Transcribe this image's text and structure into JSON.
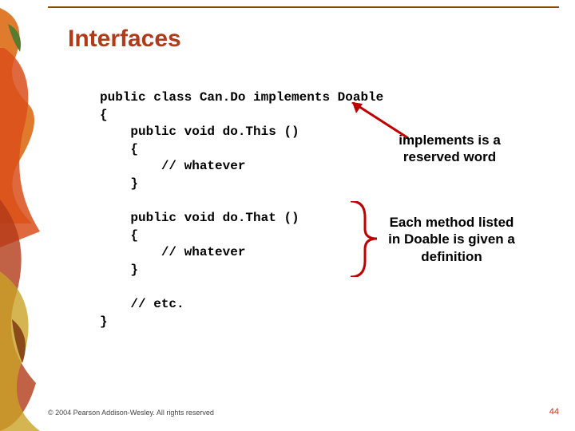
{
  "title": "Interfaces",
  "code": "public class Can.Do implements Doable\n{\n    public void do.This ()\n    {\n        // whatever\n    }\n\n    public void do.That ()\n    {\n        // whatever\n    }\n\n    // etc.\n}",
  "annotation1": "implements is a reserved word",
  "annotation2": "Each method listed in Doable is given a definition",
  "footer": "© 2004 Pearson Addison-Wesley. All rights reserved",
  "slideNumber": "44"
}
